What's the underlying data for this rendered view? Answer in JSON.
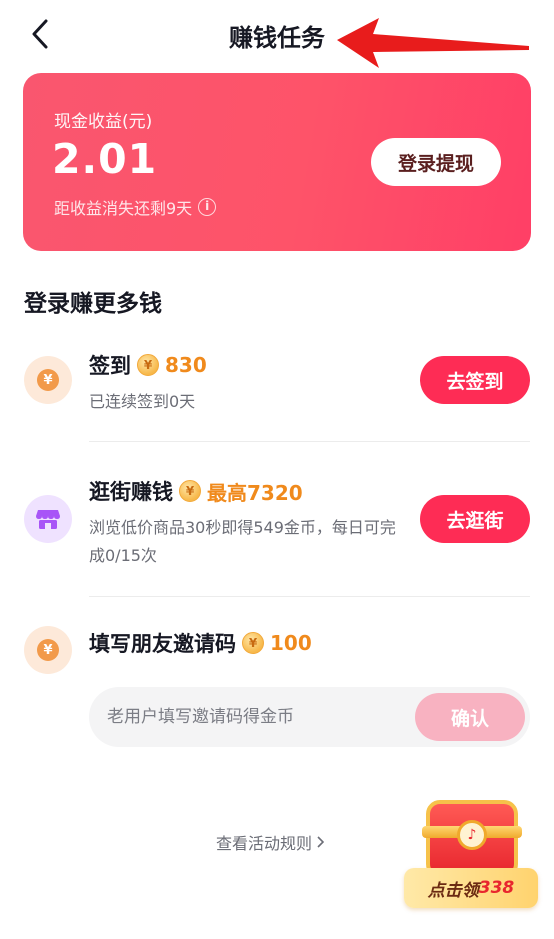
{
  "header": {
    "title": "赚钱任务",
    "back_icon": "chevron-left-icon"
  },
  "earnings": {
    "label": "现金收益(元)",
    "amount": "2.01",
    "expire_text": "距收益消失还剩9天",
    "info_icon": "info-icon",
    "button_label": "登录提现"
  },
  "section": {
    "title": "登录赚更多钱"
  },
  "tasks": [
    {
      "title": "签到",
      "reward": "830",
      "description": "已连续签到0天",
      "button_label": "去签到",
      "icon": "yuan-coin-icon"
    },
    {
      "title": "逛街赚钱",
      "reward": "最高7320",
      "description": "浏览低价商品30秒即得549金币，每日可完成0/15次",
      "button_label": "去逛街",
      "icon": "shop-icon"
    },
    {
      "title": "填写朋友邀请码",
      "reward": "100",
      "icon": "yuan-coin-icon"
    }
  ],
  "invite": {
    "placeholder": "老用户填写邀请码得金币",
    "value": "",
    "confirm_label": "确认"
  },
  "rules": {
    "label": "查看活动规则"
  },
  "treasure": {
    "claim_prefix": "点击领",
    "claim_amount": "338",
    "icon": "treasure-chest-icon"
  },
  "colors": {
    "accent": "#fe2c55",
    "reward": "#f08a1c",
    "card_gradient_start": "#f9566f",
    "card_gradient_end": "#ff3f66",
    "confirm_disabled": "#f8b2c1"
  }
}
